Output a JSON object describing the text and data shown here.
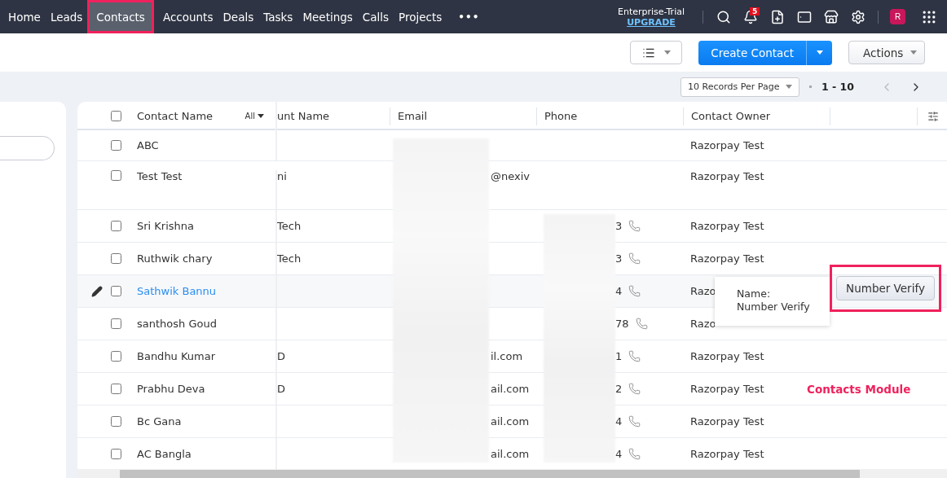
{
  "nav": {
    "items": [
      {
        "label": "Home",
        "selected": false,
        "highlighted": false
      },
      {
        "label": "Leads",
        "selected": false,
        "highlighted": false
      },
      {
        "label": "Contacts",
        "selected": true,
        "highlighted": true
      },
      {
        "label": "Accounts",
        "selected": false,
        "highlighted": false
      },
      {
        "label": "Deals",
        "selected": false,
        "highlighted": false
      },
      {
        "label": "Tasks",
        "selected": false,
        "highlighted": false
      },
      {
        "label": "Meetings",
        "selected": false,
        "highlighted": false
      },
      {
        "label": "Calls",
        "selected": false,
        "highlighted": false
      },
      {
        "label": "Projects",
        "selected": false,
        "highlighted": false
      }
    ],
    "more": "•••",
    "plan": "Enterprise-Trial",
    "upgrade": "UPGRADE",
    "notification_count": "5",
    "avatar": "R"
  },
  "toolbar": {
    "create_button": "Create Contact",
    "actions_button": "Actions"
  },
  "pagination": {
    "per_page": "10 Records Per Page",
    "range": "1 - 10"
  },
  "table": {
    "header_checked": false,
    "name_filter": "All",
    "columns": [
      "Contact Name",
      "unt Name",
      "Email",
      "Phone",
      "Contact Owner"
    ],
    "rows": [
      {
        "name": "ABC",
        "account": "",
        "email": "",
        "phone": "",
        "owner": "Razorpay Test",
        "checked": false,
        "hovered": false,
        "kind": "single"
      },
      {
        "name": "Test Test",
        "account": "ni",
        "email": "@nexiv",
        "phone": "",
        "owner": "Razorpay Test",
        "checked": false,
        "hovered": false,
        "kind": "wrapped"
      },
      {
        "name": "Sri Krishna",
        "account": "Tech",
        "email": "",
        "phone": "3",
        "owner": "Razorpay Test",
        "checked": false,
        "hovered": false,
        "kind": "single"
      },
      {
        "name": "Ruthwik chary",
        "account": "Tech",
        "email": "",
        "phone": "3",
        "owner": "Razorpay Test",
        "checked": false,
        "hovered": false,
        "kind": "single"
      },
      {
        "name": "Sathwik Bannu",
        "account": "",
        "email": "",
        "phone": "4",
        "owner": "Razo",
        "checked": false,
        "hovered": true,
        "kind": "single"
      },
      {
        "name": "santhosh Goud",
        "account": "",
        "email": "",
        "phone": "78",
        "owner": "Razo",
        "checked": false,
        "hovered": false,
        "kind": "single"
      },
      {
        "name": "Bandhu Kumar",
        "account": "D",
        "email": "il.com",
        "phone": "1",
        "owner": "Razorpay Test",
        "checked": false,
        "hovered": false,
        "kind": "single"
      },
      {
        "name": "Prabhu Deva",
        "account": "D",
        "email": "ail.com",
        "phone": "2",
        "owner": "Razorpay Test",
        "checked": false,
        "hovered": false,
        "kind": "single"
      },
      {
        "name": "Bc Gana",
        "account": "",
        "email": "ail.com",
        "phone": "4",
        "owner": "Razorpay Test",
        "checked": false,
        "hovered": false,
        "kind": "single"
      },
      {
        "name": "AC Bangla",
        "account": "",
        "email": "ail.com",
        "phone": "4",
        "owner": "Razorpay Test",
        "checked": false,
        "hovered": false,
        "kind": "single"
      }
    ]
  },
  "tooltip": {
    "label": "Name:",
    "value": "Number Verify"
  },
  "custom_button": {
    "label": "Number Verify",
    "highlighted": true
  },
  "annotation": "Contacts Module"
}
